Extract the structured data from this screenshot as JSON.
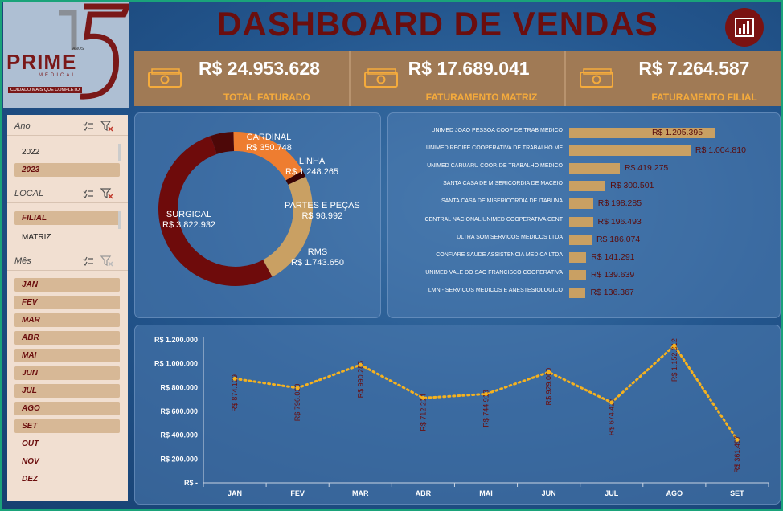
{
  "header": {
    "title": "DASHBOARD DE VENDAS",
    "logo": {
      "brand": "PRIME",
      "subbrand": "MEDICAL",
      "tagline": "CUIDADO MAIS QUE COMPLETO",
      "anos_text": "ANOS",
      "number": "15"
    },
    "icon": "bar-chart-icon"
  },
  "kpis": [
    {
      "value": "R$ 24.953.628",
      "label": "TOTAL FATURADO",
      "icon": "money-icon"
    },
    {
      "value": "R$ 17.689.041",
      "label": "FATURAMENTO MATRIZ",
      "icon": "money-icon"
    },
    {
      "value": "R$ 7.264.587",
      "label": "FATURAMENTO FILIAL",
      "icon": "money-icon"
    }
  ],
  "slicers": {
    "ano": {
      "title": "Ano",
      "items": [
        {
          "label": "2022",
          "selected": false
        },
        {
          "label": "2023",
          "selected": true
        }
      ]
    },
    "local": {
      "title": "LOCAL",
      "items": [
        {
          "label": "FILIAL",
          "selected": true
        },
        {
          "label": "MATRIZ",
          "selected": false
        }
      ]
    },
    "mes": {
      "title": "Mês",
      "items": [
        {
          "label": "JAN",
          "selected": true
        },
        {
          "label": "FEV",
          "selected": true
        },
        {
          "label": "MAR",
          "selected": true
        },
        {
          "label": "ABR",
          "selected": true
        },
        {
          "label": "MAI",
          "selected": true
        },
        {
          "label": "JUN",
          "selected": true
        },
        {
          "label": "JUL",
          "selected": true
        },
        {
          "label": "AGO",
          "selected": true
        },
        {
          "label": "SET",
          "selected": true
        },
        {
          "label": "OUT",
          "selected": false
        },
        {
          "label": "NOV",
          "selected": false
        },
        {
          "label": "DEZ",
          "selected": false
        }
      ]
    }
  },
  "colors": {
    "title": "#6b0e0e",
    "kpi_bg": "#a07a55",
    "kpi_label": "#f5ab3c",
    "bar": "#c9a063",
    "line": "#f5b21f"
  },
  "chart_data": [
    {
      "type": "pie",
      "variant": "donut",
      "categories": [
        "CARDINAL",
        "LINHA",
        "PARTES E PEÇAS",
        "RMS",
        "SURGICAL"
      ],
      "values": [
        350748,
        1248265,
        98992,
        1743650,
        3822932
      ],
      "labels": [
        "R$ 350.748",
        "R$ 1.248.265",
        "R$ 98.992",
        "R$ 1.743.650",
        "R$ 3.822.932"
      ],
      "colors": [
        "#4d0808",
        "#ee7d30",
        "#3a0505",
        "#c9a063",
        "#6e0b0b"
      ]
    },
    {
      "type": "bar",
      "orientation": "horizontal",
      "categories": [
        "UNIMED JOAO PESSOA COOP DE TRAB MEDICO",
        "UNIMED RECIFE COOPERATIVA DE TRABALHO ME",
        "UNIMED CARUARU COOP. DE TRABALHO MEDICO",
        "SANTA CASA DE MISERICORDIA DE MACEIO",
        "SANTA CASA DE MISERICORDIA DE ITABUNA",
        "CENTRAL NACIONAL UNIMED COOPERATIVA CENT",
        "ULTRA SOM SERVICOS MEDICOS LTDA",
        "CONFIARE SAUDE ASSISTENCIA MEDICA LTDA",
        "UNIMED VALE DO SAO FRANCISCO COOPERATIVA",
        "LMN - SERVICOS MEDICOS E ANESTESIOLOGICO"
      ],
      "values": [
        1205395,
        1004810,
        419275,
        300501,
        198285,
        196493,
        186074,
        141291,
        139639,
        136367
      ],
      "labels": [
        "R$ 1.205.395",
        "R$ 1.004.810",
        "R$ 419.275",
        "R$ 300.501",
        "R$ 198.285",
        "R$ 196.493",
        "R$ 186.074",
        "R$ 141.291",
        "R$ 139.639",
        "R$ 136.367"
      ]
    },
    {
      "type": "line",
      "categories": [
        "JAN",
        "FEV",
        "MAR",
        "ABR",
        "MAI",
        "JUN",
        "JUL",
        "AGO",
        "SET"
      ],
      "values": [
        874129,
        796030,
        990285,
        712214,
        744918,
        929000,
        674428,
        1152012,
        361497
      ],
      "labels": [
        "R$ 874.129",
        "R$ 796.030",
        "R$ 990.285",
        "R$ 712.214",
        "R$ 744.918",
        "R$ 929.000",
        "R$ 674.428",
        "R$ 1.152.012",
        "R$ 361.497"
      ],
      "yticks": [
        "R$ -",
        "R$ 200.000",
        "R$ 400.000",
        "R$ 600.000",
        "R$ 800.000",
        "R$ 1.000.000",
        "R$ 1.200.000"
      ],
      "ylim": [
        0,
        1200000
      ],
      "line_style": "dotted"
    }
  ]
}
